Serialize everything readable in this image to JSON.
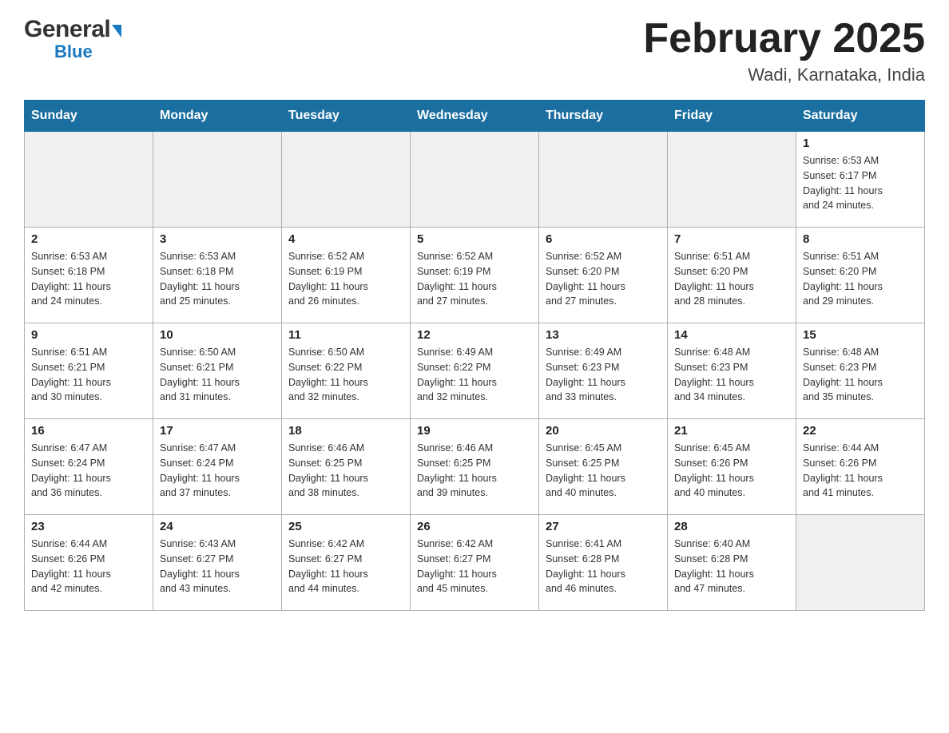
{
  "header": {
    "logo_general": "General",
    "logo_blue": "Blue",
    "month_title": "February 2025",
    "location": "Wadi, Karnataka, India"
  },
  "weekdays": [
    "Sunday",
    "Monday",
    "Tuesday",
    "Wednesday",
    "Thursday",
    "Friday",
    "Saturday"
  ],
  "weeks": [
    [
      {
        "day": "",
        "info": ""
      },
      {
        "day": "",
        "info": ""
      },
      {
        "day": "",
        "info": ""
      },
      {
        "day": "",
        "info": ""
      },
      {
        "day": "",
        "info": ""
      },
      {
        "day": "",
        "info": ""
      },
      {
        "day": "1",
        "info": "Sunrise: 6:53 AM\nSunset: 6:17 PM\nDaylight: 11 hours\nand 24 minutes."
      }
    ],
    [
      {
        "day": "2",
        "info": "Sunrise: 6:53 AM\nSunset: 6:18 PM\nDaylight: 11 hours\nand 24 minutes."
      },
      {
        "day": "3",
        "info": "Sunrise: 6:53 AM\nSunset: 6:18 PM\nDaylight: 11 hours\nand 25 minutes."
      },
      {
        "day": "4",
        "info": "Sunrise: 6:52 AM\nSunset: 6:19 PM\nDaylight: 11 hours\nand 26 minutes."
      },
      {
        "day": "5",
        "info": "Sunrise: 6:52 AM\nSunset: 6:19 PM\nDaylight: 11 hours\nand 27 minutes."
      },
      {
        "day": "6",
        "info": "Sunrise: 6:52 AM\nSunset: 6:20 PM\nDaylight: 11 hours\nand 27 minutes."
      },
      {
        "day": "7",
        "info": "Sunrise: 6:51 AM\nSunset: 6:20 PM\nDaylight: 11 hours\nand 28 minutes."
      },
      {
        "day": "8",
        "info": "Sunrise: 6:51 AM\nSunset: 6:20 PM\nDaylight: 11 hours\nand 29 minutes."
      }
    ],
    [
      {
        "day": "9",
        "info": "Sunrise: 6:51 AM\nSunset: 6:21 PM\nDaylight: 11 hours\nand 30 minutes."
      },
      {
        "day": "10",
        "info": "Sunrise: 6:50 AM\nSunset: 6:21 PM\nDaylight: 11 hours\nand 31 minutes."
      },
      {
        "day": "11",
        "info": "Sunrise: 6:50 AM\nSunset: 6:22 PM\nDaylight: 11 hours\nand 32 minutes."
      },
      {
        "day": "12",
        "info": "Sunrise: 6:49 AM\nSunset: 6:22 PM\nDaylight: 11 hours\nand 32 minutes."
      },
      {
        "day": "13",
        "info": "Sunrise: 6:49 AM\nSunset: 6:23 PM\nDaylight: 11 hours\nand 33 minutes."
      },
      {
        "day": "14",
        "info": "Sunrise: 6:48 AM\nSunset: 6:23 PM\nDaylight: 11 hours\nand 34 minutes."
      },
      {
        "day": "15",
        "info": "Sunrise: 6:48 AM\nSunset: 6:23 PM\nDaylight: 11 hours\nand 35 minutes."
      }
    ],
    [
      {
        "day": "16",
        "info": "Sunrise: 6:47 AM\nSunset: 6:24 PM\nDaylight: 11 hours\nand 36 minutes."
      },
      {
        "day": "17",
        "info": "Sunrise: 6:47 AM\nSunset: 6:24 PM\nDaylight: 11 hours\nand 37 minutes."
      },
      {
        "day": "18",
        "info": "Sunrise: 6:46 AM\nSunset: 6:25 PM\nDaylight: 11 hours\nand 38 minutes."
      },
      {
        "day": "19",
        "info": "Sunrise: 6:46 AM\nSunset: 6:25 PM\nDaylight: 11 hours\nand 39 minutes."
      },
      {
        "day": "20",
        "info": "Sunrise: 6:45 AM\nSunset: 6:25 PM\nDaylight: 11 hours\nand 40 minutes."
      },
      {
        "day": "21",
        "info": "Sunrise: 6:45 AM\nSunset: 6:26 PM\nDaylight: 11 hours\nand 40 minutes."
      },
      {
        "day": "22",
        "info": "Sunrise: 6:44 AM\nSunset: 6:26 PM\nDaylight: 11 hours\nand 41 minutes."
      }
    ],
    [
      {
        "day": "23",
        "info": "Sunrise: 6:44 AM\nSunset: 6:26 PM\nDaylight: 11 hours\nand 42 minutes."
      },
      {
        "day": "24",
        "info": "Sunrise: 6:43 AM\nSunset: 6:27 PM\nDaylight: 11 hours\nand 43 minutes."
      },
      {
        "day": "25",
        "info": "Sunrise: 6:42 AM\nSunset: 6:27 PM\nDaylight: 11 hours\nand 44 minutes."
      },
      {
        "day": "26",
        "info": "Sunrise: 6:42 AM\nSunset: 6:27 PM\nDaylight: 11 hours\nand 45 minutes."
      },
      {
        "day": "27",
        "info": "Sunrise: 6:41 AM\nSunset: 6:28 PM\nDaylight: 11 hours\nand 46 minutes."
      },
      {
        "day": "28",
        "info": "Sunrise: 6:40 AM\nSunset: 6:28 PM\nDaylight: 11 hours\nand 47 minutes."
      },
      {
        "day": "",
        "info": ""
      }
    ]
  ]
}
